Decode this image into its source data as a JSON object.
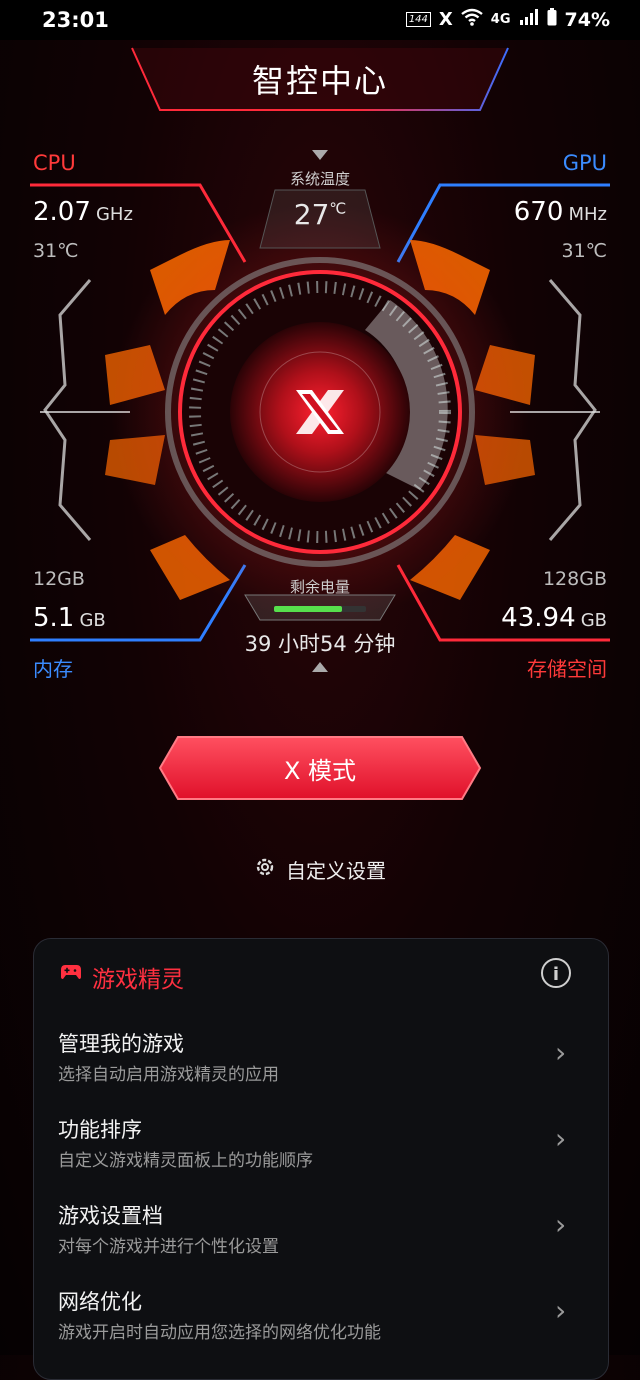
{
  "status": {
    "time": "23:01",
    "battery": "74%",
    "net": "4G",
    "hz": "144"
  },
  "title": "智控中心",
  "cpu": {
    "label": "CPU",
    "freq_value": "2.07",
    "freq_unit": "GHz",
    "temp": "31℃"
  },
  "gpu": {
    "label": "GPU",
    "freq_value": "670",
    "freq_unit": "MHz",
    "temp": "31℃"
  },
  "system_temp": {
    "label": "系统温度",
    "value": "27",
    "unit": "℃"
  },
  "memory": {
    "label": "内存",
    "total": "12GB",
    "used_value": "5.1",
    "used_unit": "GB"
  },
  "storage": {
    "label": "存储空间",
    "total": "128GB",
    "used_value": "43.94",
    "used_unit": "GB"
  },
  "battery_remaining": {
    "label": "剩余电量",
    "time": "39 小时54 分钟",
    "level_fraction": 0.74
  },
  "mode_button": "X 模式",
  "custom_settings": "自定义设置",
  "game_genie": {
    "title": "游戏精灵",
    "items": [
      {
        "title": "管理我的游戏",
        "subtitle": "选择自动启用游戏精灵的应用"
      },
      {
        "title": "功能排序",
        "subtitle": "自定义游戏精灵面板上的功能顺序"
      },
      {
        "title": "游戏设置档",
        "subtitle": "对每个游戏并进行个性化设置"
      },
      {
        "title": "网络优化",
        "subtitle": "游戏开启时自动应用您选择的网络优化功能"
      }
    ]
  },
  "colors": {
    "accent_red": "#ff2a3a",
    "accent_blue": "#2f7fff",
    "orange": "#ff6a00"
  }
}
